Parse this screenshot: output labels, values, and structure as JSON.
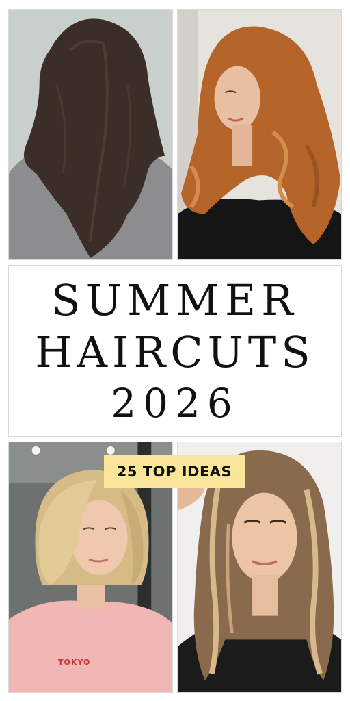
{
  "title": {
    "line1": "SUMMER",
    "line2": "HAIRCUTS",
    "line3": "2026"
  },
  "badge": {
    "label": "25 TOP IDEAS",
    "color": "#fbe59a"
  },
  "photos": [
    {
      "name": "long-dark-layered-hair-back-view",
      "background": "#c9cfcd",
      "hair": "#3b2d27"
    },
    {
      "name": "copper-voluminous-waves",
      "background": "#e6e2de",
      "hair": "#b5652a"
    },
    {
      "name": "blonde-bob-pink-shirt",
      "background": "#6d7270",
      "hair": "#d6bb86"
    },
    {
      "name": "balayage-long-layers",
      "background": "#f0efed",
      "hair": "#8a6a4c"
    }
  ],
  "shirt_text": "TOKYO"
}
